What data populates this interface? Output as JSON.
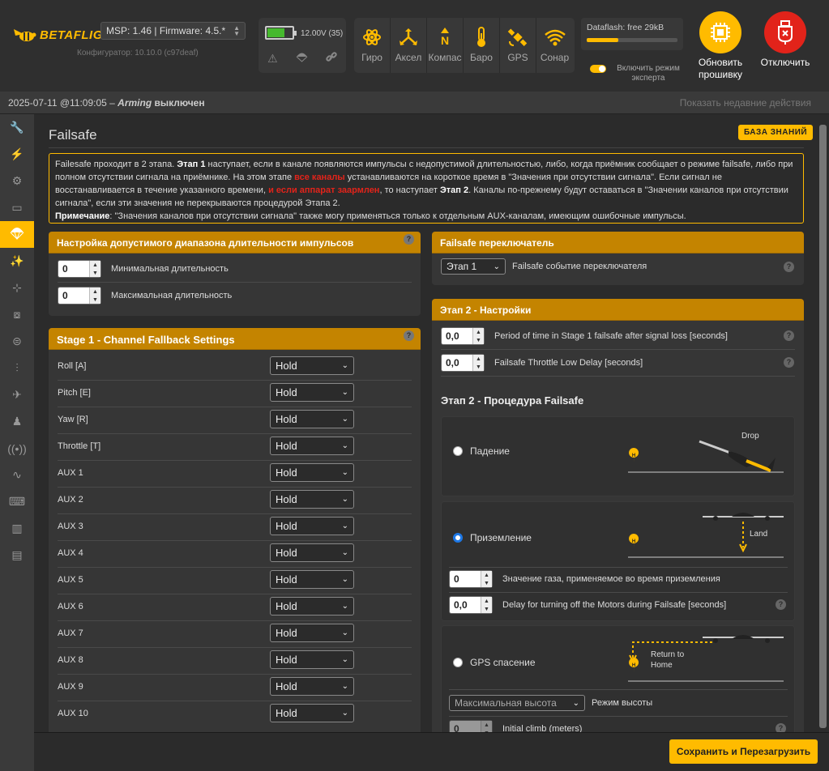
{
  "header": {
    "logo_text": "BETAFLIGHT",
    "configurator_version": "Конфигуратор: 10.10.0 (c97deaf)",
    "firmware_select": "MSP: 1.46 | Firmware: 4.5.*",
    "battery": {
      "voltage": "12.00V (35)",
      "level": 0.7
    },
    "sensors": [
      {
        "label": "Гиро",
        "icon": "gyro-icon",
        "active": true
      },
      {
        "label": "Аксел",
        "icon": "accel-icon",
        "active": true
      },
      {
        "label": "Компас",
        "icon": "compass-icon",
        "active": true
      },
      {
        "label": "Баро",
        "icon": "baro-icon",
        "active": true
      },
      {
        "label": "GPS",
        "icon": "gps-icon",
        "active": true
      },
      {
        "label": "Сонар",
        "icon": "sonar-icon",
        "active": true
      }
    ],
    "dataflash": "Dataflash: free 29kB",
    "expert_mode": "Включить режим эксперта",
    "flash_button": "Обновить прошивку",
    "disconnect_button": "Отключить"
  },
  "status": {
    "datetime": "2025-07-11 @11:09:05",
    "separator": " – ",
    "arming_label": "Arming",
    "arming_state": "выключен",
    "recent_actions": "Показать недавние действия"
  },
  "sidebar": {
    "icons": [
      "wrench-icon",
      "plug-icon",
      "gear-icon",
      "port-icon",
      "failsafe-icon",
      "wand-icon",
      "tree-icon",
      "receiver-icon",
      "toggles-icon",
      "sliders-icon",
      "gps-icon",
      "motor-icon",
      "broadcast-icon",
      "pulse-icon",
      "keyboard-icon",
      "chip-icon",
      "terminal-icon"
    ],
    "active_index": 4
  },
  "page": {
    "title": "Failsafe",
    "wiki_button": "БАЗА ЗНАНИЙ",
    "note": {
      "p1": "Failesafe проходит в 2 этапа. ",
      "p2": "Этап 1",
      "p3": " наступает, если в канале появляются импульсы с недопустимой длительностью, либо, когда приёмник сообщает о режиме failsafe, либо при полном отсутствии сигнала на приёмнике. На этом этапе ",
      "p4": "все каналы",
      "p5": " устанавливаются на короткое время в \"Значения при отсутствии сигнала\". Если сигнал не восстанавливается в течение указанного времени, ",
      "p6": "и если аппарат заармлен",
      "p7": ", то наступает ",
      "p8": "Этап 2",
      "p9": ". Каналы по-прежнему будут оставаться в \"Значении каналов при отсутствии сигнала\", если эти значения не перекрываются процедурой Этапа 2.",
      "p10": "Примечание",
      "p11": ": \"Значения каналов при отсутствии сигнала\" также могу применяться только к отдельным AUX-каналам, имеющим ошибочные импульсы."
    }
  },
  "pulse_range": {
    "title": "Настройка допустимого диапазона длительности импульсов",
    "min_value": "0",
    "min_label": "Минимальная длительность",
    "max_value": "0",
    "max_label": "Максимальная длительность"
  },
  "stage1": {
    "title": "Stage 1 - Channel Fallback Settings",
    "channels": [
      {
        "name": "Roll [A]",
        "mode": "Hold"
      },
      {
        "name": "Pitch [E]",
        "mode": "Hold"
      },
      {
        "name": "Yaw [R]",
        "mode": "Hold"
      },
      {
        "name": "Throttle [T]",
        "mode": "Hold"
      },
      {
        "name": "AUX 1",
        "mode": "Hold"
      },
      {
        "name": "AUX 2",
        "mode": "Hold"
      },
      {
        "name": "AUX 3",
        "mode": "Hold"
      },
      {
        "name": "AUX 4",
        "mode": "Hold"
      },
      {
        "name": "AUX 5",
        "mode": "Hold"
      },
      {
        "name": "AUX 6",
        "mode": "Hold"
      },
      {
        "name": "AUX 7",
        "mode": "Hold"
      },
      {
        "name": "AUX 8",
        "mode": "Hold"
      },
      {
        "name": "AUX 9",
        "mode": "Hold"
      },
      {
        "name": "AUX 10",
        "mode": "Hold"
      }
    ]
  },
  "switch_panel": {
    "title": "Failsafe переключатель",
    "select_value": "Этап 1",
    "label": "Failsafe событие переключателя"
  },
  "stage2": {
    "title": "Этап 2 - Настройки",
    "guard_value": "0,0",
    "guard_label": "Period of time in Stage 1 failsafe after signal loss [seconds]",
    "throttle_delay_value": "0,0",
    "throttle_delay_label": "Failsafe Throttle Low Delay [seconds]",
    "procedure_title": "Этап 2 - Процедура Failsafe",
    "drop": {
      "label": "Падение",
      "diagram_text": "Drop"
    },
    "land": {
      "label": "Приземление",
      "diagram_text": "Land",
      "throttle_value": "0",
      "throttle_label": "Значение газа, применяемое во время приземления",
      "motors_delay_value": "0,0",
      "motors_delay_label": "Delay for turning off the Motors during Failsafe [seconds]"
    },
    "gps": {
      "label": "GPS спасение",
      "diagram_text_1": "Return to",
      "diagram_text_2": "Home",
      "alt_mode_value": "Максимальная высота",
      "alt_mode_label": "Режим высоты",
      "climb_value": "0",
      "climb_label": "Initial climb (meters)"
    },
    "home_marker": "H"
  },
  "footer": {
    "save_button": "Сохранить и Перезагрузить"
  },
  "colors": {
    "accent": "#ffbb00",
    "panel_header": "#c48400",
    "disconnect": "#e2231a",
    "red_text": "#e2231a",
    "radio": "#1e78e6"
  }
}
